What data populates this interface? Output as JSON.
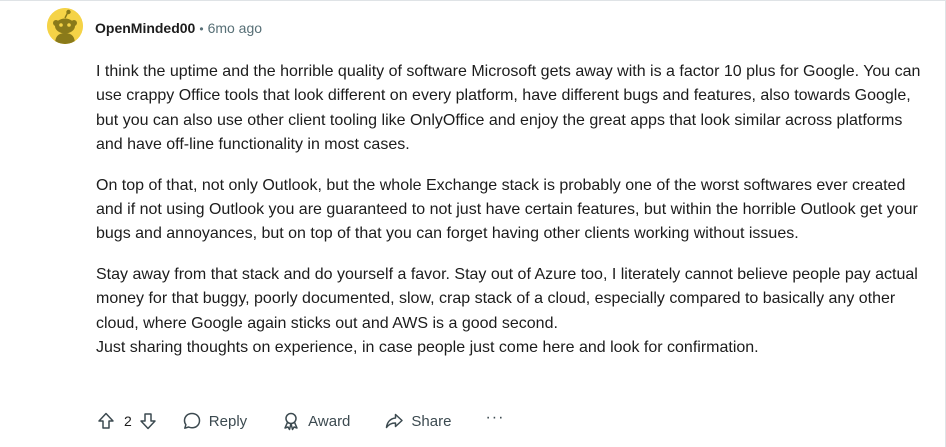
{
  "comment": {
    "author": "OpenMinded00",
    "separator": "•",
    "time_ago": "6mo ago",
    "avatar_icon": "snoo-avatar-icon",
    "avatar_color": "#f5d347",
    "paragraphs": [
      "I think the uptime and the horrible quality of software Microsoft gets away with is a factor 10 plus for Google. You can use crappy Office tools that look different on every platform, have different bugs and features, also towards Google, but you can also use other client tooling like OnlyOffice and enjoy the great apps that look similar across platforms and have off-line functionality in most cases.",
      "On top of that, not only Outlook, but the whole Exchange stack is probably one of the worst softwares ever created and if not using Outlook you are guaranteed to not just have certain features, but within the horrible Outlook get your bugs and annoyances, but on top of that you can forget having other clients working without issues.",
      "Stay away from that stack and do yourself a favor. Stay out of Azure too, I literately cannot believe people pay actual money for that buggy, poorly documented, slow, crap stack of a cloud, especially compared to basically any other cloud, where Google again sticks out and AWS is a good second."
    ],
    "last_line": "Just sharing thoughts on experience, in case people just come here and look for confirmation."
  },
  "actions": {
    "upvote_icon": "upvote-arrow-icon",
    "vote_count": "2",
    "downvote_icon": "downvote-arrow-icon",
    "reply_label": "Reply",
    "reply_icon": "speech-bubble-icon",
    "award_label": "Award",
    "award_icon": "award-ribbon-icon",
    "share_label": "Share",
    "share_icon": "share-arrow-icon",
    "more_label": "···",
    "more_icon": "ellipsis-icon"
  },
  "colors": {
    "text": "#1c1c1c",
    "muted": "#576f76",
    "action": "#3c4a50"
  }
}
